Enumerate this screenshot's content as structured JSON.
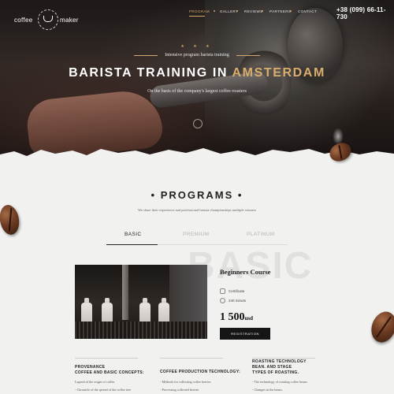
{
  "header": {
    "logo": {
      "word_left": "coffee",
      "word_right": "maker"
    },
    "nav": [
      {
        "label": "PROGRAM",
        "active": true
      },
      {
        "label": "GALLERY",
        "active": false
      },
      {
        "label": "REVIEWS",
        "active": false
      },
      {
        "label": "PARTNERS",
        "active": false
      },
      {
        "label": "CONTACT",
        "active": false
      }
    ],
    "phone": "+38 (099) 66-11-730"
  },
  "hero": {
    "stars": "★ ★ ★",
    "subtitle": "Intensive program barista training",
    "title_part1": "BARISTA TRAINING IN ",
    "title_part2": "AMSTERDAM",
    "tagline": "On the basis of the company's largest coffee roasters"
  },
  "programs": {
    "title": "• PROGRAMS •",
    "description": "We share their experience and professional barista championships multiple winners",
    "tabs": [
      {
        "label": "BASIC",
        "active": true
      },
      {
        "label": "PREMIUM",
        "active": false
      },
      {
        "label": "PLATINUM",
        "active": false
      }
    ],
    "background_word": "BASIC",
    "course": {
      "name": "Beginners Course",
      "certificate": "Certificate",
      "duration": "240 minuts",
      "price": "1 500",
      "currency": "usd",
      "button": "REGISTRATION"
    },
    "columns": [
      {
        "title_line1": "PROVENANCE",
        "title_line2": "COFFEE AND BASIC CONCEPTS:",
        "title_line3": "",
        "items": [
          "Legend of the origin of coffee.",
          "- Chronicle of the spread of the coffee tree"
        ]
      },
      {
        "title_line1": "COFFEE PRODUCTION TECHNOLOGY:",
        "title_line2": "",
        "title_line3": "",
        "items": [
          "- Methods for collecting coffee berries",
          "- Processing collected berries"
        ]
      },
      {
        "title_line1": "ROASTING TECHNOLOGY",
        "title_line2": "BEAN. AND STAGE",
        "title_line3": "TYPES OF ROASTING.",
        "items": [
          "- The technology of roasting coffee beans.",
          "- Changes in the beans."
        ]
      }
    ]
  },
  "colors": {
    "accent": "#d3a86a",
    "dark": "#161616",
    "background": "#f1f1f0"
  }
}
